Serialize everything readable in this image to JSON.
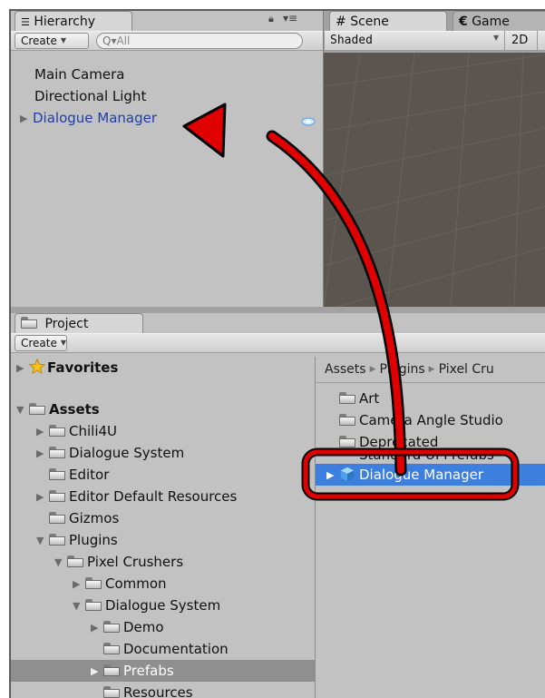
{
  "hierarchy": {
    "tab_label": "Hierarchy",
    "create_label": "Create",
    "search_placeholder": "All",
    "items": [
      {
        "label": "Main Camera"
      },
      {
        "label": "Directional Light"
      },
      {
        "label": "Dialogue Manager"
      }
    ]
  },
  "scene": {
    "tabs": [
      {
        "label": "Scene"
      },
      {
        "label": "Game"
      }
    ],
    "shading_mode": "Shaded",
    "mode_2d_label": "2D"
  },
  "project": {
    "tab_label": "Project",
    "create_label": "Create",
    "favorites_label": "Favorites",
    "tree": [
      {
        "label": "Assets"
      },
      {
        "label": "Chili4U"
      },
      {
        "label": "Dialogue System"
      },
      {
        "label": "Editor"
      },
      {
        "label": "Editor Default Resources"
      },
      {
        "label": "Gizmos"
      },
      {
        "label": "Plugins"
      },
      {
        "label": "Pixel Crushers"
      },
      {
        "label": "Common"
      },
      {
        "label": "Dialogue System"
      },
      {
        "label": "Demo"
      },
      {
        "label": "Documentation"
      },
      {
        "label": "Prefabs"
      },
      {
        "label": "Resources"
      }
    ],
    "breadcrumb": [
      "Assets",
      "Plugins",
      "Pixel Cru"
    ],
    "contents": [
      {
        "label": "Art"
      },
      {
        "label": "Camera Angle Studio"
      },
      {
        "label": "Deprecated"
      },
      {
        "label": "Standard UI Prefabs"
      },
      {
        "label": "Dialogue Manager"
      }
    ]
  },
  "colors": {
    "annotation_red": "#e00000",
    "selection_blue": "#3d7fdf",
    "prefab_text_blue": "#1c3fa8"
  }
}
